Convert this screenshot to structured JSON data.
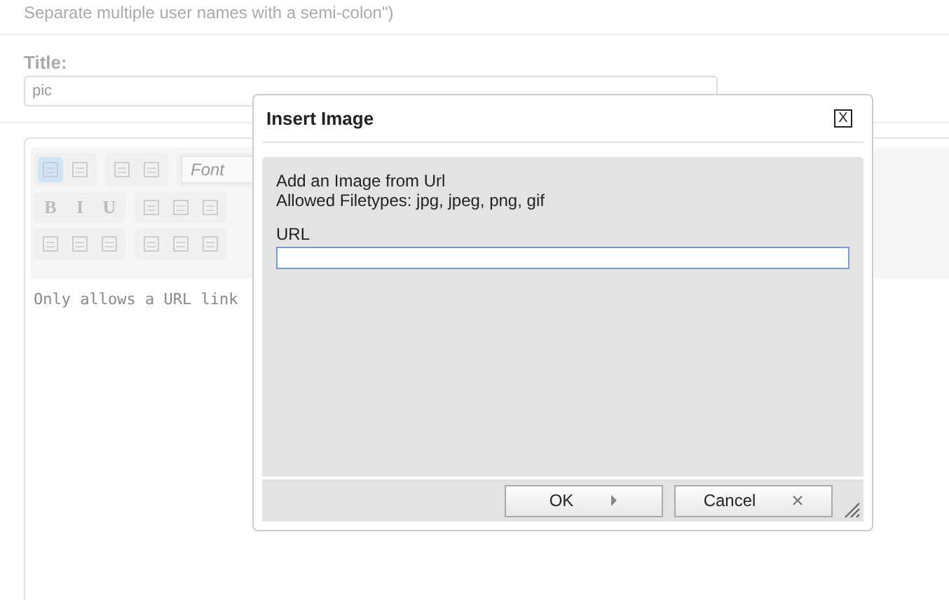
{
  "page": {
    "hint": "Separate multiple user names with a semi-colon\")",
    "title_label": "Title:",
    "title_value": "pic"
  },
  "editor": {
    "toolbar": [
      [
        [
          {
            "kind": "icon",
            "selected": true
          },
          {
            "kind": "icon",
            "selected": false
          }
        ],
        [
          {
            "kind": "icon",
            "selected": false
          },
          {
            "kind": "icon",
            "selected": false
          }
        ],
        [
          {
            "kind": "select",
            "placeholder": "Font"
          }
        ]
      ],
      [
        [
          {
            "kind": "text",
            "label": "B",
            "selected": false
          },
          {
            "kind": "text",
            "label": "I",
            "selected": false
          },
          {
            "kind": "text",
            "label": "U",
            "selected": false
          }
        ],
        [
          {
            "kind": "icon",
            "selected": false
          },
          {
            "kind": "icon",
            "selected": false
          },
          {
            "kind": "icon",
            "selected": false
          }
        ]
      ],
      [
        [
          {
            "kind": "icon",
            "selected": false
          },
          {
            "kind": "icon",
            "selected": false
          },
          {
            "kind": "icon",
            "selected": false
          }
        ],
        [
          {
            "kind": "icon",
            "selected": false
          },
          {
            "kind": "icon",
            "selected": false
          },
          {
            "kind": "icon",
            "selected": false
          }
        ]
      ]
    ],
    "content": "Only allows a URL link"
  },
  "dialog": {
    "title": "Insert Image",
    "close": "X",
    "lines": [
      "Add an Image from Url",
      "Allowed Filetypes: jpg, jpeg, png, gif"
    ],
    "field_label": "URL",
    "buttons": [
      {
        "label": "OK",
        "kind": "ok"
      },
      {
        "label": "Cancel",
        "kind": "cancel"
      }
    ]
  }
}
